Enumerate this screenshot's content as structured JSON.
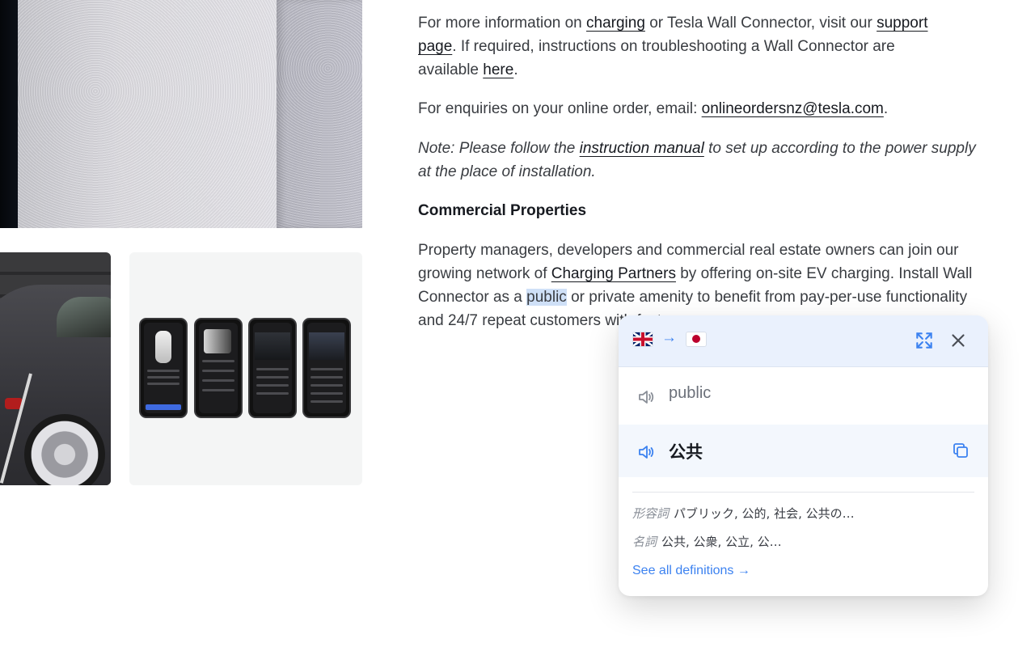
{
  "images": {
    "wall": "wall-connector-photo",
    "car": "car-charging-photo",
    "app": "tesla-app-screens"
  },
  "article": {
    "p1": {
      "t1": "For more information on ",
      "l1": "charging",
      "t2": " or Tesla Wall Connector, visit our ",
      "l2": "support page",
      "t3": ". If required, instructions on troubleshooting a Wall Connector are available ",
      "l3": "here",
      "t4": "."
    },
    "p2": {
      "t1": "For enquiries on your online order, email: ",
      "l1": "onlineordersnz@tesla.com",
      "t2": "."
    },
    "p3": {
      "t1": "Note: Please follow the ",
      "l1": "instruction manual",
      "t2": " to set up according to the power supply at the place of installation."
    },
    "heading": "Commercial Properties",
    "p5": {
      "t1": "Property managers, developers and commercial real estate owners can join our growing network of ",
      "l1": "Charging Partners",
      "t2": " by offering on-site EV charging. Install Wall Connector as a ",
      "hl": "public",
      "t3": " or private amenity to benefit from pay-per-use functionality and 24/7 ",
      "t4": "repeat customers with fast"
    }
  },
  "translator": {
    "source_flag": "uk-flag-icon",
    "target_flag": "japan-flag-icon",
    "arrow": "→",
    "source_word": "public",
    "translation": "公共",
    "definitions": [
      {
        "pos": "形容詞",
        "text": "パブリック, 公的, 社会, 公共の…"
      },
      {
        "pos": "名詞",
        "text": "公共, 公衆, 公立, 公…"
      }
    ],
    "see_all": "See all definitions →",
    "accent_color": "#3c82f0",
    "highlight_color": "#cfe0f7"
  }
}
